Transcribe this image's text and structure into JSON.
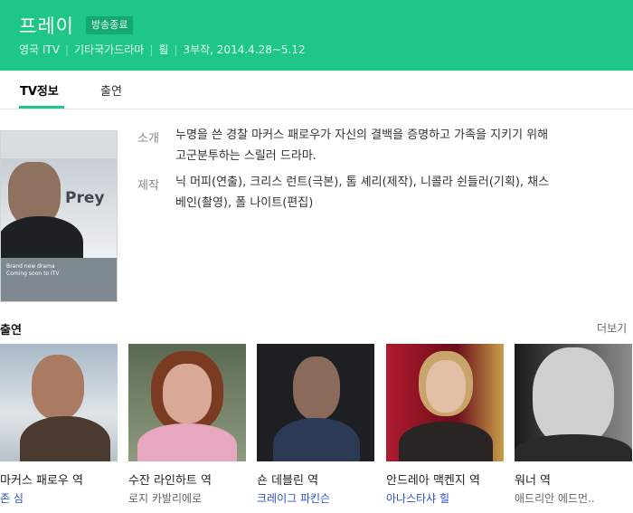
{
  "header": {
    "title": "프레이",
    "badge": "방송종료",
    "meta": [
      "영국 ITV",
      "기타국가드라마",
      "휠",
      "3부작, 2014.4.28~5.12"
    ]
  },
  "tabs": [
    {
      "label": "TV정보"
    },
    {
      "label": "출연"
    }
  ],
  "poster": {
    "title_text": "Prey",
    "caption_line1": "Brand new drama",
    "caption_line2": "Coming soon to ITV"
  },
  "info": {
    "intro_label": "소개",
    "intro_line1": "누명을 쓴 경찰 마커스 패로우가 자신의 결백을 증명하고 가족을 지키기 위해",
    "intro_line2": "고군분투하는 스릴러 드라마.",
    "production_label": "제작",
    "production_line1": "닉 머피(연출), 크리스 런트(극본), 톰 셰리(제작), 니콜라 쉰들러(기획), 채스",
    "production_line2": "베인(촬영), 폴 나이트(편집)"
  },
  "cast_section": {
    "title": "출연",
    "more": "더보기"
  },
  "cast": [
    {
      "role": "마커스 패로우 역",
      "actor": "존 심",
      "link": true
    },
    {
      "role": "수잔 라인하트 역",
      "actor": "로지 카발리에로",
      "link": false
    },
    {
      "role": "숀 데블린 역",
      "actor": "크레이그 파킨슨",
      "link": true
    },
    {
      "role": "안드레아 맥켄지 역",
      "actor": "아나스타샤 힐",
      "link": true
    },
    {
      "role": "워너 역",
      "actor": "애드리안 에드먼..",
      "link": false
    }
  ],
  "colors": {
    "brand": "#1ec787",
    "link": "#2b50c8"
  }
}
